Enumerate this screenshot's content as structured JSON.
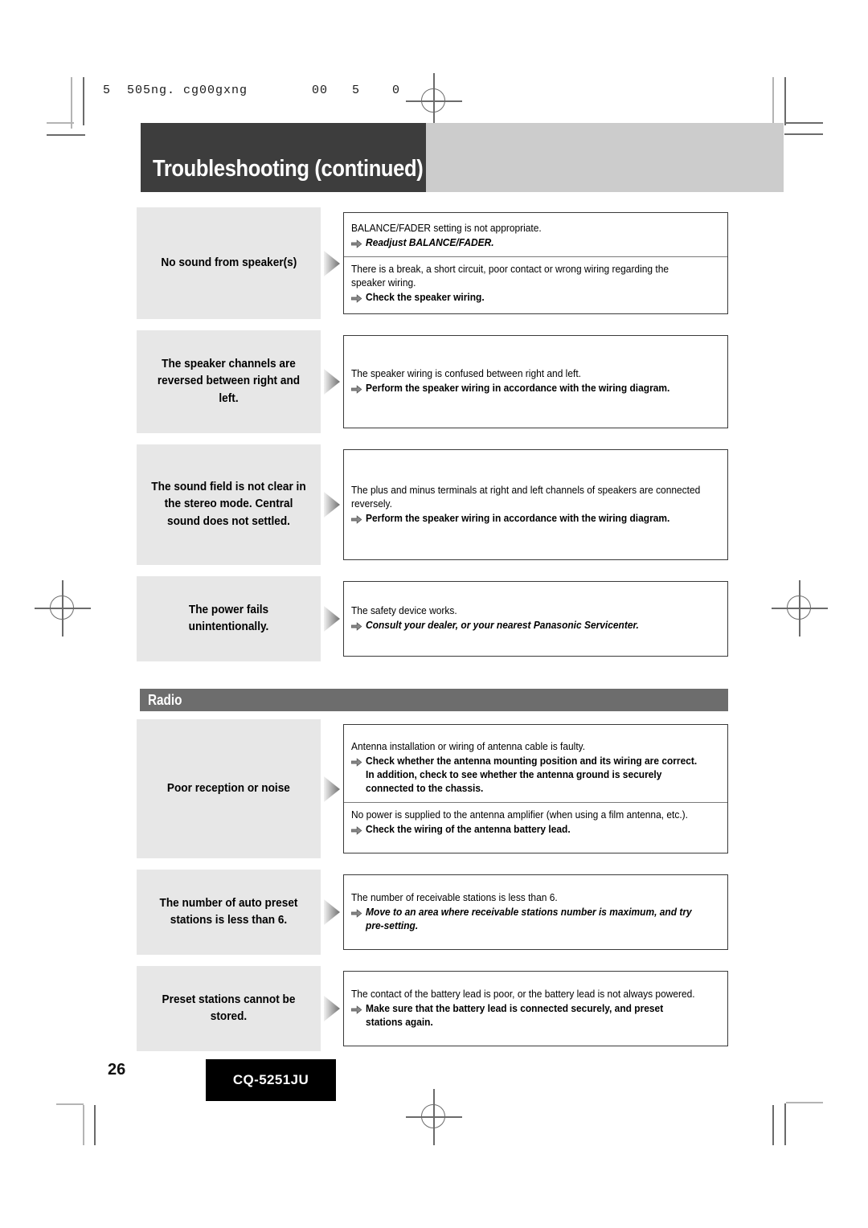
{
  "scan_header": "5  505ng. cg00gxng        00   5    0",
  "title": "Troubleshooting (continued)",
  "sections": [
    {
      "heading": null,
      "rows": [
        {
          "symptom": "No sound from speaker(s)",
          "cells": [
            {
              "cause": "BALANCE/FADER setting is not appropriate.",
              "remedy": "Readjust BALANCE/FADER.",
              "remedy_style": "italic"
            },
            {
              "cause": "There is a break, a short circuit, poor contact or wrong wiring regarding the speaker wiring.",
              "remedy": "Check the speaker wiring.",
              "remedy_style": "bold"
            }
          ]
        },
        {
          "symptom": "The speaker channels are reversed between right and left.",
          "cells": [
            {
              "cause": "The speaker wiring is confused between right and left.",
              "remedy": "Perform the speaker wiring in accordance with the wiring diagram.",
              "remedy_style": "bold"
            }
          ]
        },
        {
          "symptom": "The sound field is not clear in the stereo mode. Central sound does not settled.",
          "cells": [
            {
              "cause": "The plus and minus terminals at right and left channels of speakers are connected reversely.",
              "remedy": "Perform the speaker wiring in accordance with the wiring diagram.",
              "remedy_style": "bold"
            }
          ]
        },
        {
          "symptom": "The power fails unintentionally.",
          "cells": [
            {
              "cause": "The safety device works.",
              "remedy": "Consult your dealer, or your nearest Panasonic Servicenter.",
              "remedy_style": "italic"
            }
          ]
        }
      ]
    },
    {
      "heading": "Radio",
      "rows": [
        {
          "symptom": "Poor reception or noise",
          "cells": [
            {
              "cause": "Antenna installation or wiring of antenna cable is faulty.",
              "remedy": "Check whether the antenna mounting position and its wiring are correct. In addition, check to see whether the antenna ground is securely connected to the chassis.",
              "remedy_style": "bold"
            },
            {
              "cause": "No power is supplied to the antenna amplifier (when using a film antenna, etc.).",
              "remedy": "Check the wiring of the antenna battery lead.",
              "remedy_style": "bold"
            }
          ]
        },
        {
          "symptom": "The number of auto preset stations is less than 6.",
          "cells": [
            {
              "cause": "The number of receivable stations is less than 6.",
              "remedy": "Move to an area where receivable stations number is maximum, and try pre-setting.",
              "remedy_style": "italic"
            }
          ]
        },
        {
          "symptom": "Preset stations cannot be stored.",
          "cells": [
            {
              "cause": "The contact of the battery lead is poor, or the battery lead is not always powered.",
              "remedy": "Make sure that the battery lead is connected securely, and preset stations again.",
              "remedy_style": "bold"
            }
          ]
        }
      ]
    }
  ],
  "footer": {
    "page_number": "26",
    "model": "CQ-5251JU"
  },
  "colors": {
    "title_block": "#3d3d3d",
    "title_banner": "#cccccc",
    "section_bar": "#6d6d6d",
    "symptom_bg": "#e7e7e7",
    "box_border": "#3a3a3a",
    "model_box": "#000000"
  },
  "icons": {
    "pointer": "triangle-right-icon",
    "remedy_arrow": "arrow-right-icon",
    "registration": "registration-mark-icon"
  }
}
